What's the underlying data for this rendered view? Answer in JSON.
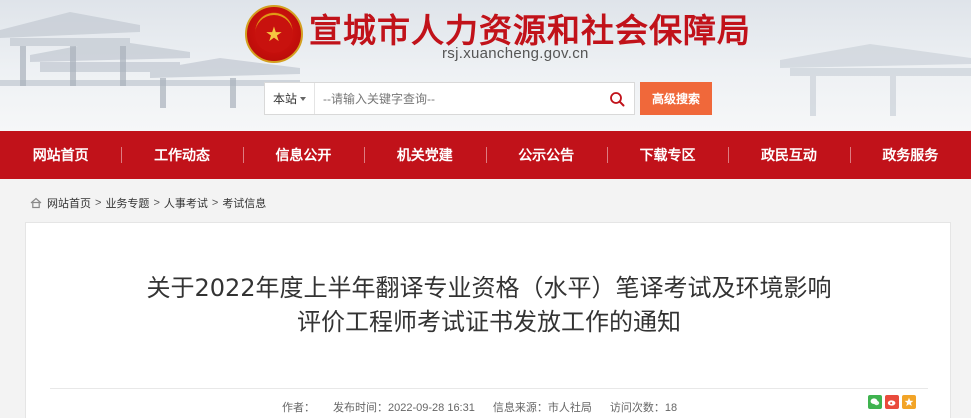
{
  "header": {
    "site_title": "宣城市人力资源和社会保障局",
    "domain": "rsj.xuancheng.gov.cn",
    "emblem_icon": "national-emblem-icon"
  },
  "search": {
    "scope_label": "本站",
    "placeholder": "--请输入关键字查询--",
    "advanced_label": "高级搜索"
  },
  "nav": {
    "items": [
      {
        "label": "网站首页"
      },
      {
        "label": "工作动态"
      },
      {
        "label": "信息公开"
      },
      {
        "label": "机关党建"
      },
      {
        "label": "公示公告"
      },
      {
        "label": "下载专区"
      },
      {
        "label": "政民互动"
      },
      {
        "label": "政务服务"
      }
    ]
  },
  "breadcrumb": {
    "items": [
      "网站首页",
      "业务专题",
      "人事考试",
      "考试信息"
    ],
    "separator": ">"
  },
  "article": {
    "title_line1": "关于2022年度上半年翻译专业资格（水平）笔译考试及环境影响",
    "title_line2": "评价工程师考试证书发放工作的通知",
    "meta": {
      "author_label": "作者：",
      "author_value": "",
      "time_label": "发布时间：",
      "time_value": "2022-09-28 16:31",
      "source_label": "信息来源：",
      "source_value": "市人社局",
      "views_label": "访问次数：",
      "views_value": "18"
    }
  },
  "colors": {
    "brand_red": "#c1121a",
    "search_orange": "#f0683a"
  }
}
